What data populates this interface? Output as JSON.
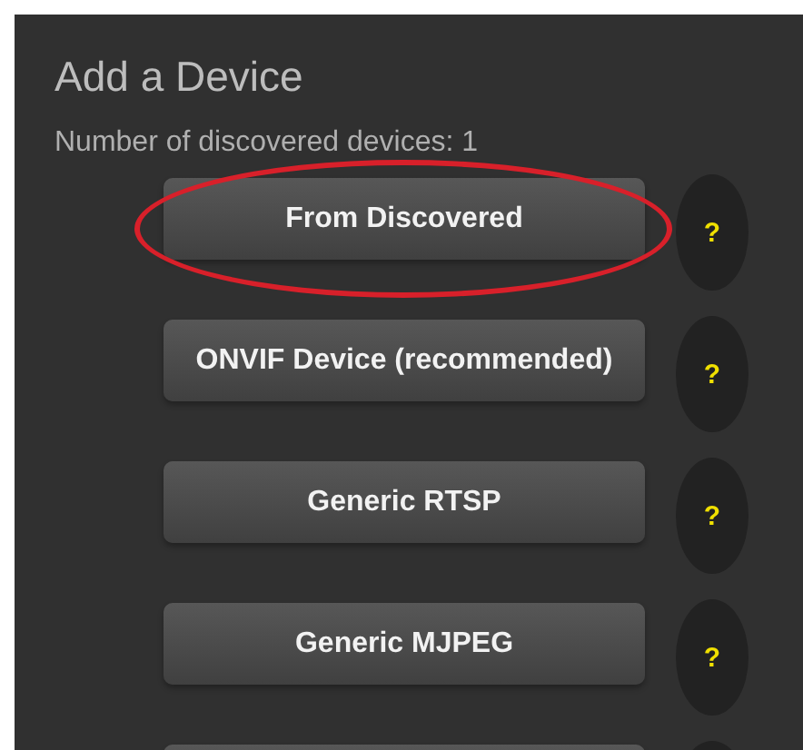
{
  "title": "Add a Device",
  "subtitle": "Number of discovered devices: 1",
  "options": [
    {
      "label": "From Discovered",
      "help": "?",
      "circled": true
    },
    {
      "label": "ONVIF Device (recommended)",
      "help": "?",
      "circled": false
    },
    {
      "label": "Generic RTSP",
      "help": "?",
      "circled": false
    },
    {
      "label": "Generic MJPEG",
      "help": "?",
      "circled": false
    },
    {
      "circled": false
    }
  ]
}
